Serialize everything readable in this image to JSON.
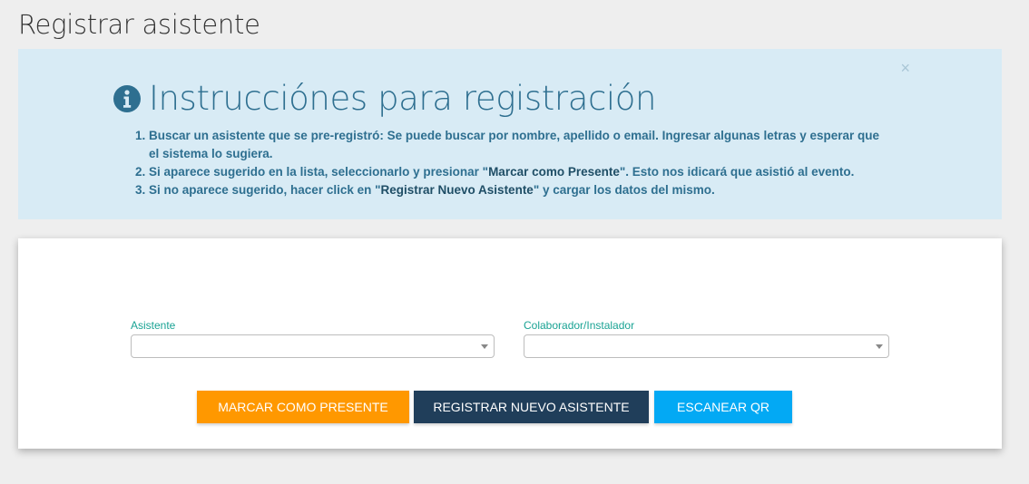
{
  "page": {
    "title": "Registrar asistente"
  },
  "alert": {
    "close_symbol": "×",
    "heading": "Instrucciónes para registración",
    "icon": "info-circle-icon",
    "items": [
      {
        "before": "Buscar un asistente que se pre-registró: Se puede buscar por nombre, apellido o email. Ingresar algunas letras y esperar que el sistema lo sugiera.",
        "bold": "",
        "after": ""
      },
      {
        "before": "Si aparece sugerido en la lista, seleccionarlo y presionar \"",
        "bold": "Marcar como Presente",
        "after": "\". Esto nos idicará que asistió al evento."
      },
      {
        "before": "Si no aparece sugerido, hacer click en \"",
        "bold": "Registrar Nuevo Asistente",
        "after": "\" y cargar los datos del mismo."
      }
    ]
  },
  "form": {
    "asistente": {
      "label": "Asistente",
      "value": ""
    },
    "colaborador": {
      "label": "Colaborador/Instalador",
      "value": ""
    }
  },
  "buttons": {
    "marcar": {
      "label": "MARCAR COMO PRESENTE",
      "color": "#ff9800"
    },
    "registrar": {
      "label": "REGISTRAR NUEVO ASISTENTE",
      "color": "#203e5a"
    },
    "escanear": {
      "label": "ESCANEAR QR",
      "color": "#03a9f4"
    }
  },
  "colors": {
    "alert_bg": "#d8ebf5",
    "alert_text": "#2e6f90",
    "label_accent": "#1aa394"
  }
}
